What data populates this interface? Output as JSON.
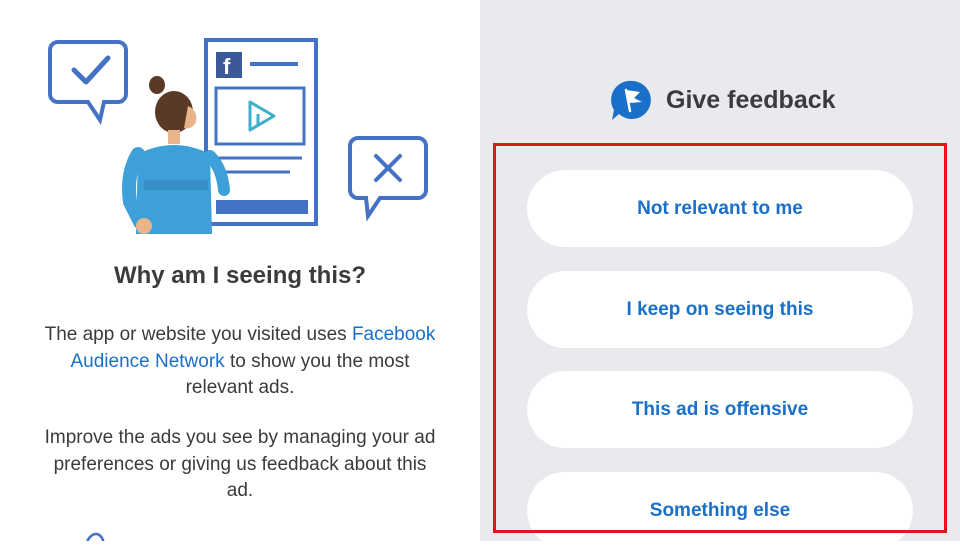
{
  "colors": {
    "accent": "#1a6fc9",
    "text": "#3a3b3d",
    "right_panel_bg": "#e9eaed",
    "highlight_border": "#e8141c",
    "illustration_blue": "#4472c4"
  },
  "explanation": {
    "heading": "Why am I seeing this?",
    "para1_before": "The app or website you visited uses",
    "para1_link": "Facebook Audience Network",
    "para1_after": "to show you the most relevant ads.",
    "para2": "Improve the ads you see by managing your ad preferences or giving us feedback about this ad."
  },
  "feedback": {
    "title": "Give feedback",
    "icon": "feedback-flag-icon",
    "options": [
      {
        "label": "Not relevant to me"
      },
      {
        "label": "I keep on seeing this"
      },
      {
        "label": "This ad is offensive"
      },
      {
        "label": "Something else"
      }
    ]
  },
  "illustration_icons": [
    "checkmark-bubble-icon",
    "close-bubble-icon",
    "facebook-icon",
    "play-icon"
  ]
}
